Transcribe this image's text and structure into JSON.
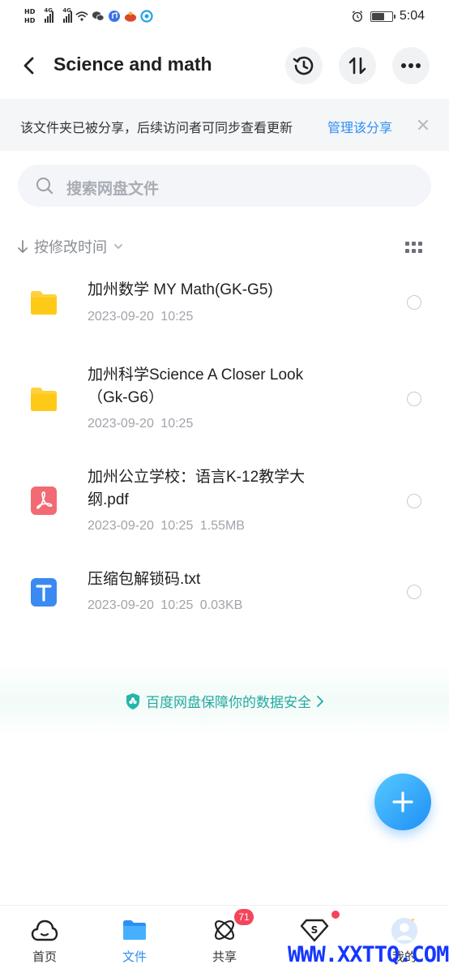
{
  "status_bar": {
    "hd1": "HD",
    "hd2": "HD",
    "net1": "4G",
    "net2": "4G",
    "time": "5:04",
    "battery_level": 0.65
  },
  "nav": {
    "title": "Science and math"
  },
  "share_banner": {
    "text": "该文件夹已被分享，后续访问者可同步查看更新",
    "link": "管理该分享"
  },
  "search": {
    "placeholder": "搜索网盘文件"
  },
  "sort": {
    "label": "按修改时间"
  },
  "files": [
    {
      "name": "加州数学 MY Math(GK-G5)",
      "date": "2023-09-20",
      "time": "10:25",
      "size": "",
      "icon": "folder-icon"
    },
    {
      "name": "加州科学Science A Closer Look（Gk-G6）",
      "date": "2023-09-20",
      "time": "10:25",
      "size": "",
      "icon": "folder-icon"
    },
    {
      "name": "加州公立学校：语言K-12教学大纲.pdf",
      "date": "2023-09-20",
      "time": "10:25",
      "size": "1.55MB",
      "icon": "pdf-icon"
    },
    {
      "name": "压缩包解锁码.txt",
      "date": "2023-09-20",
      "time": "10:25",
      "size": "0.03KB",
      "icon": "txt-icon"
    }
  ],
  "safety": {
    "text": "百度网盘保障你的数据安全"
  },
  "tabs": [
    {
      "label": "首页",
      "icon": "cloud-home-icon",
      "active": false
    },
    {
      "label": "文件",
      "icon": "folder-tab-icon",
      "active": true
    },
    {
      "label": "共享",
      "icon": "orbit-share-icon",
      "active": false,
      "badge": "71"
    },
    {
      "label": "",
      "icon": "diamond-s-icon",
      "active": false
    },
    {
      "label": "我的",
      "icon": "avatar-icon",
      "active": false
    }
  ],
  "watermark": "WWW.XXTTQ.COM",
  "colors": {
    "accent": "#2e8ef5",
    "folder": "#ffd23d",
    "pdf": "#f26a73",
    "txt": "#3a8af2",
    "badge": "#f4455b",
    "safety": "#25a9a0"
  }
}
